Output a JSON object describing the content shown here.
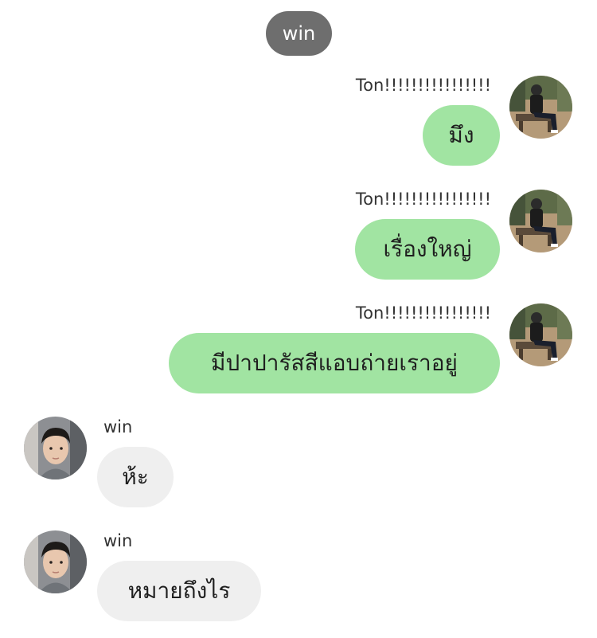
{
  "chat": {
    "title": "win"
  },
  "messages": [
    {
      "sender": "Ton!!!!!!!!!!!!!!!!",
      "text": "มึง",
      "side": "right"
    },
    {
      "sender": "Ton!!!!!!!!!!!!!!!!",
      "text": "เรื่องใหญ่",
      "side": "right"
    },
    {
      "sender": "Ton!!!!!!!!!!!!!!!!",
      "text": "มีปาปารัสสีแอบถ่ายเราอยู่",
      "side": "right"
    },
    {
      "sender": "win",
      "text": "ห้ะ",
      "side": "left"
    },
    {
      "sender": "win",
      "text": "หมายถึงไร",
      "side": "left"
    }
  ],
  "colors": {
    "my_bubble": "#a1e4a2",
    "their_bubble": "#efefef",
    "header_pill": "#6e6e6e"
  },
  "icons": {
    "ton_avatar": "avatar-person-sitting-on-bench",
    "win_avatar": "avatar-face-portrait"
  }
}
